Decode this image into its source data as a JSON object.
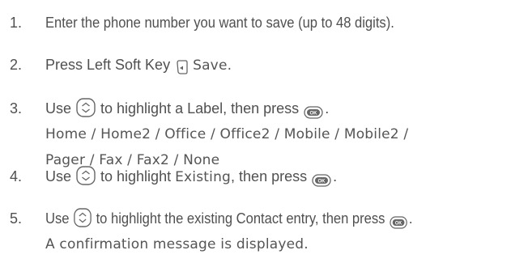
{
  "steps": [
    {
      "number": "1.",
      "text": "Enter the phone number you want to save (up to 48 digits)."
    },
    {
      "number": "2.",
      "before": "Press Left Soft Key",
      "label": "Save."
    },
    {
      "number": "3.",
      "before": "Use",
      "middle": "to highlight a Label, then press",
      "after": ".",
      "options_line1": "Home / Home2 / Office / Office2 / Mobile / Mobile2 /",
      "options_line2": "Pager / Fax / Fax2 / None"
    },
    {
      "number": "4.",
      "before": "Use",
      "middle": "to highlight",
      "option": "Existing",
      "middle2": ", then press",
      "after": "."
    },
    {
      "number": "5.",
      "before": "Use",
      "middle": "to highlight the existing Contact entry, then press",
      "after": ".",
      "line2": "A confirmation message is displayed."
    }
  ],
  "icons": {
    "nav_key": "navigation-key-icon",
    "ok_key": "ok-key-icon",
    "ok_label": "OK",
    "soft_key": "left-soft-key-icon"
  }
}
